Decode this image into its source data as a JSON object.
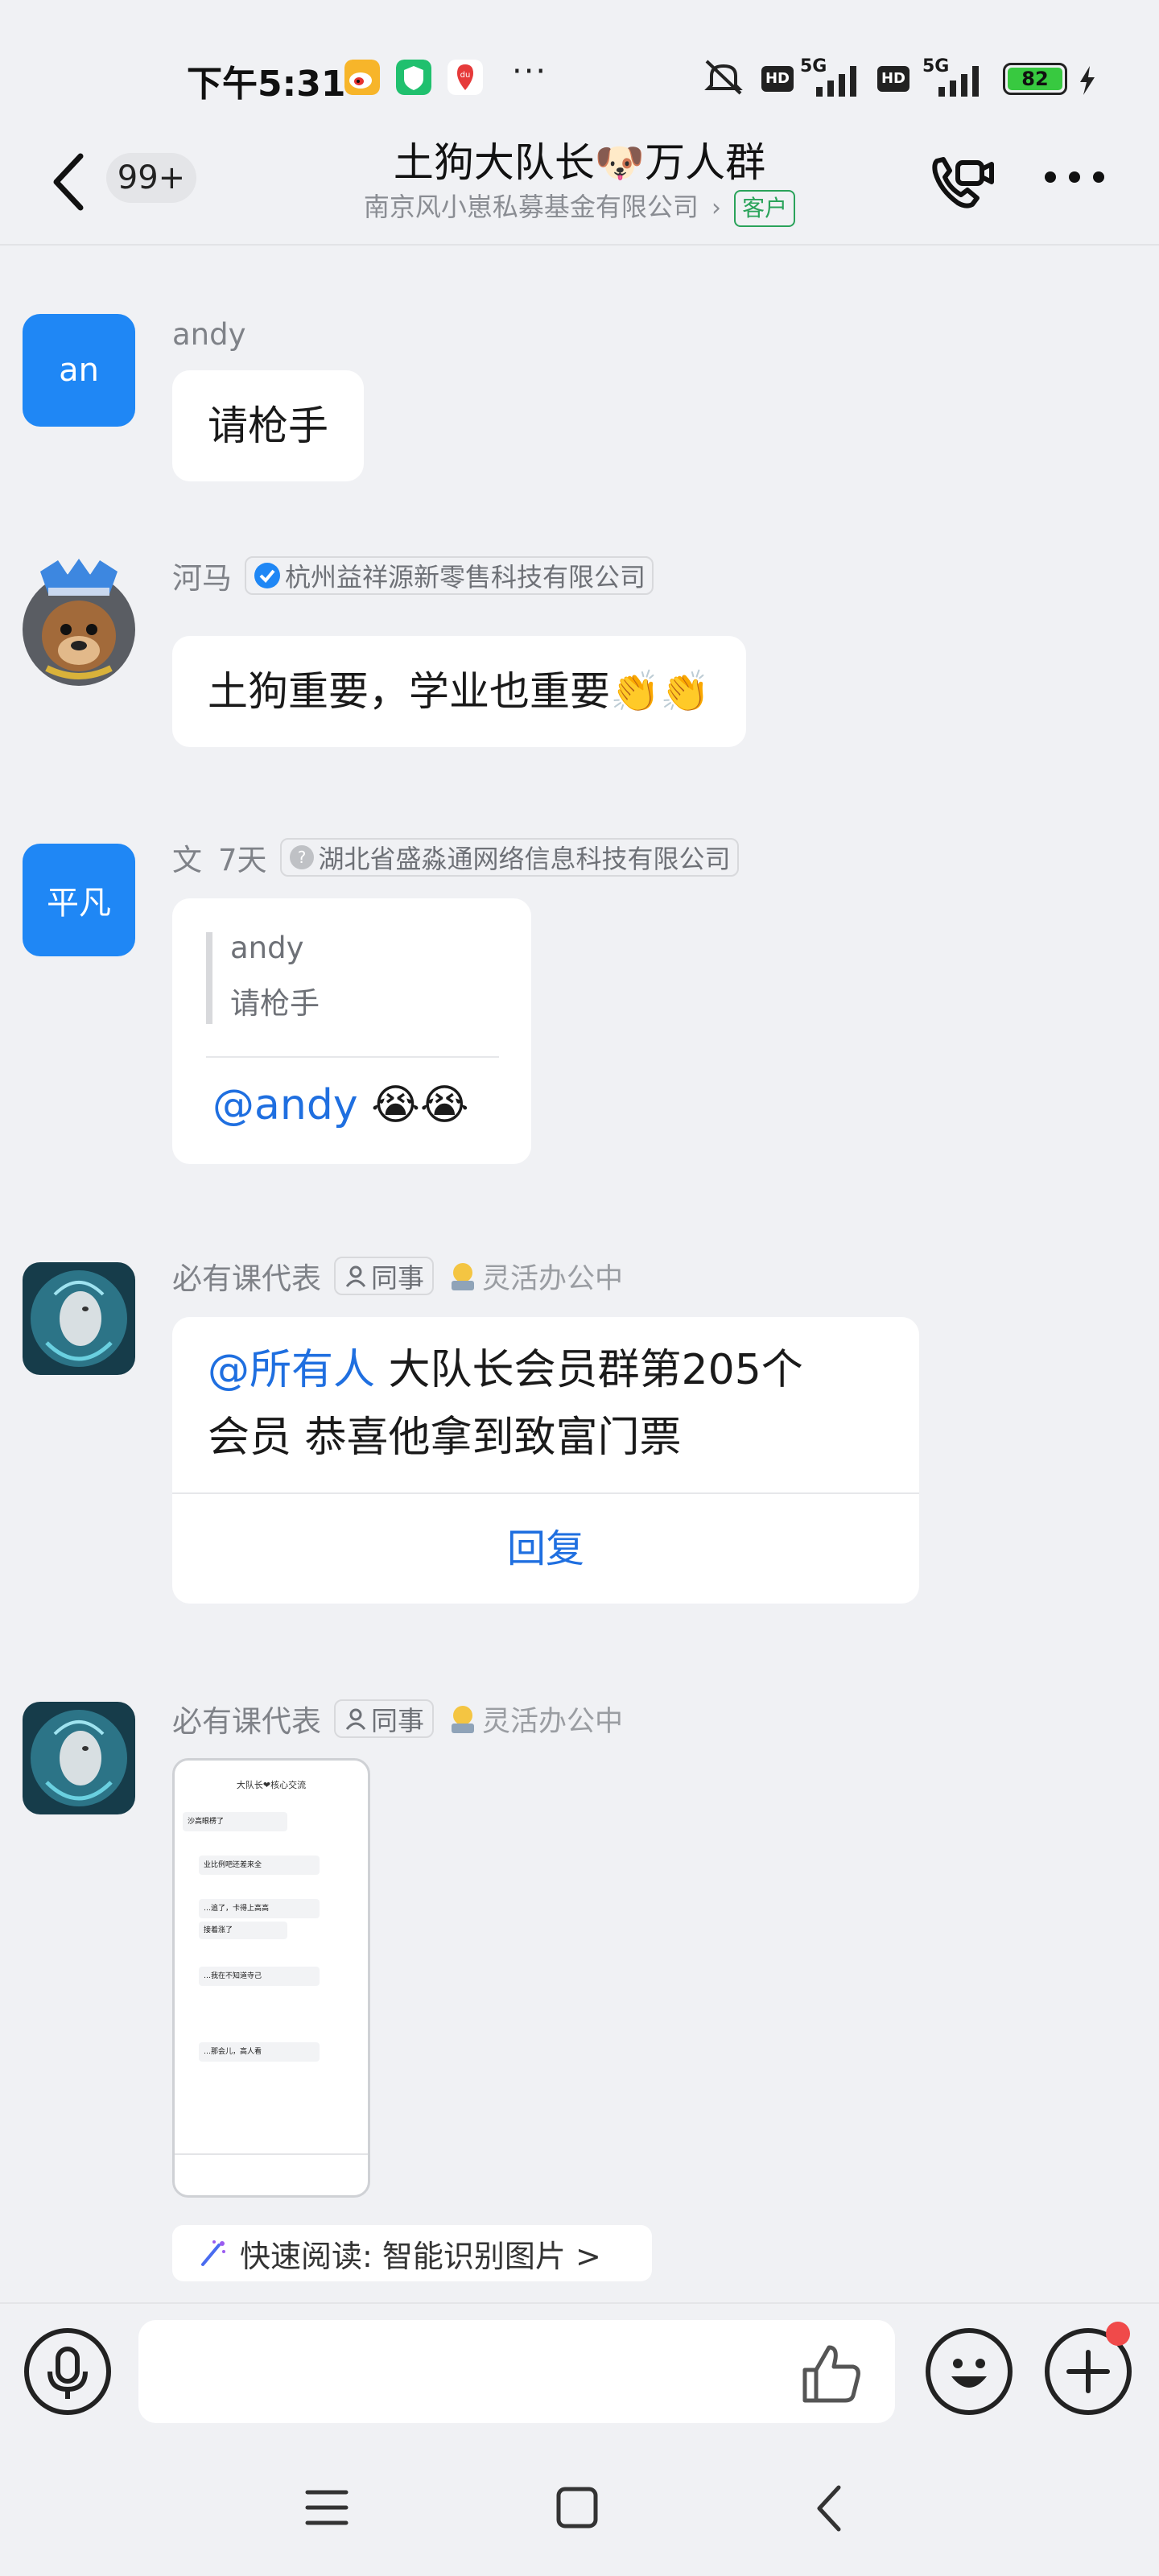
{
  "status_bar": {
    "time": "下午5:31",
    "battery": "82",
    "network_1": "5G",
    "network_2": "5G",
    "hd_1": "HD",
    "hd_2": "HD",
    "more": "···"
  },
  "header": {
    "back_icon": "chevron-left-icon",
    "unread_count": "99+",
    "title": "土狗大队长🐶万人群",
    "subtitle": "南京风小崽私募基金有限公司",
    "tag": "客户"
  },
  "messages": [
    {
      "avatar_text": "an",
      "sender": "andy",
      "text": "请枪手"
    },
    {
      "sender": "河马",
      "org": "杭州益祥源新零售科技有限公司",
      "text": "土狗重要，学业也重要👏👏"
    },
    {
      "avatar_text": "平凡",
      "sender": "文",
      "time": "7天",
      "org": "湖北省盛淼通网络信息科技有限公司",
      "quote_sender": "andy",
      "quote_text": "请枪手",
      "mention": "@andy",
      "emoji": "😭😭"
    },
    {
      "sender": "必有课代表",
      "tag": "同事",
      "status": "灵活办公中",
      "mention": "@所有人",
      "line1": " 大队长会员群第205个",
      "line2": "会员   恭喜他拿到致富门票",
      "reply_label": "回复"
    },
    {
      "sender": "必有课代表",
      "tag": "同事",
      "status": "灵活办公中",
      "image_title": "大队长❤核心交流",
      "image_lines": [
        "沙高眼楞了",
        "业比例吧还差来全",
        "…追了，卡得上高高",
        "接着涨了",
        "…我在不知道寺己",
        "…那会儿，高人看"
      ],
      "quick_read": "快速阅读: 智能识别图片 >"
    }
  ],
  "input": {
    "placeholder": ""
  },
  "colors": {
    "accent": "#1f87f5",
    "mention": "#1f6fe0",
    "tag_green": "#2aa35a",
    "background": "#f0f1f4"
  }
}
